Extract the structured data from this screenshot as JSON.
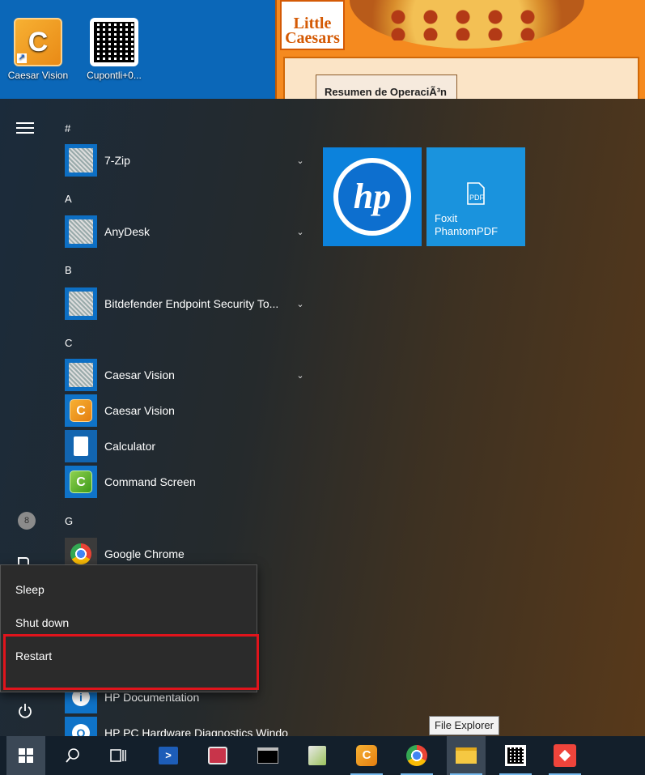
{
  "desktop": {
    "icons": [
      {
        "label": "Caesar Vision"
      },
      {
        "label": "Cupontli+0..."
      }
    ],
    "background_window": {
      "logo_text": "Little\nCaesars",
      "tab_label": "Resumen de OperaciÃ³n"
    }
  },
  "start_menu": {
    "letters": {
      "hash": "#",
      "a": "A",
      "b": "B",
      "c": "C",
      "g": "G"
    },
    "apps": [
      {
        "name": "7-Zip"
      },
      {
        "name": "AnyDesk"
      },
      {
        "name": "Bitdefender Endpoint Security To..."
      },
      {
        "name": "Caesar Vision"
      },
      {
        "name": "Caesar Vision"
      },
      {
        "name": "Calculator"
      },
      {
        "name": "Command Screen"
      },
      {
        "name": "Google Chrome"
      },
      {
        "name": "HP Documentation"
      },
      {
        "name": "HP PC Hardware Diagnostics Windo"
      }
    ],
    "tiles": {
      "hp_label": "hp",
      "foxit_label": "Foxit\nPhantomPDF"
    },
    "power_menu": {
      "sleep": "Sleep",
      "shutdown": "Shut down",
      "restart": "Restart"
    }
  },
  "taskbar": {
    "tooltip": "File Explorer"
  },
  "colors": {
    "accent": "#0c82dc",
    "highlight_box": "#e0141c",
    "taskbar": "#131f2b"
  }
}
